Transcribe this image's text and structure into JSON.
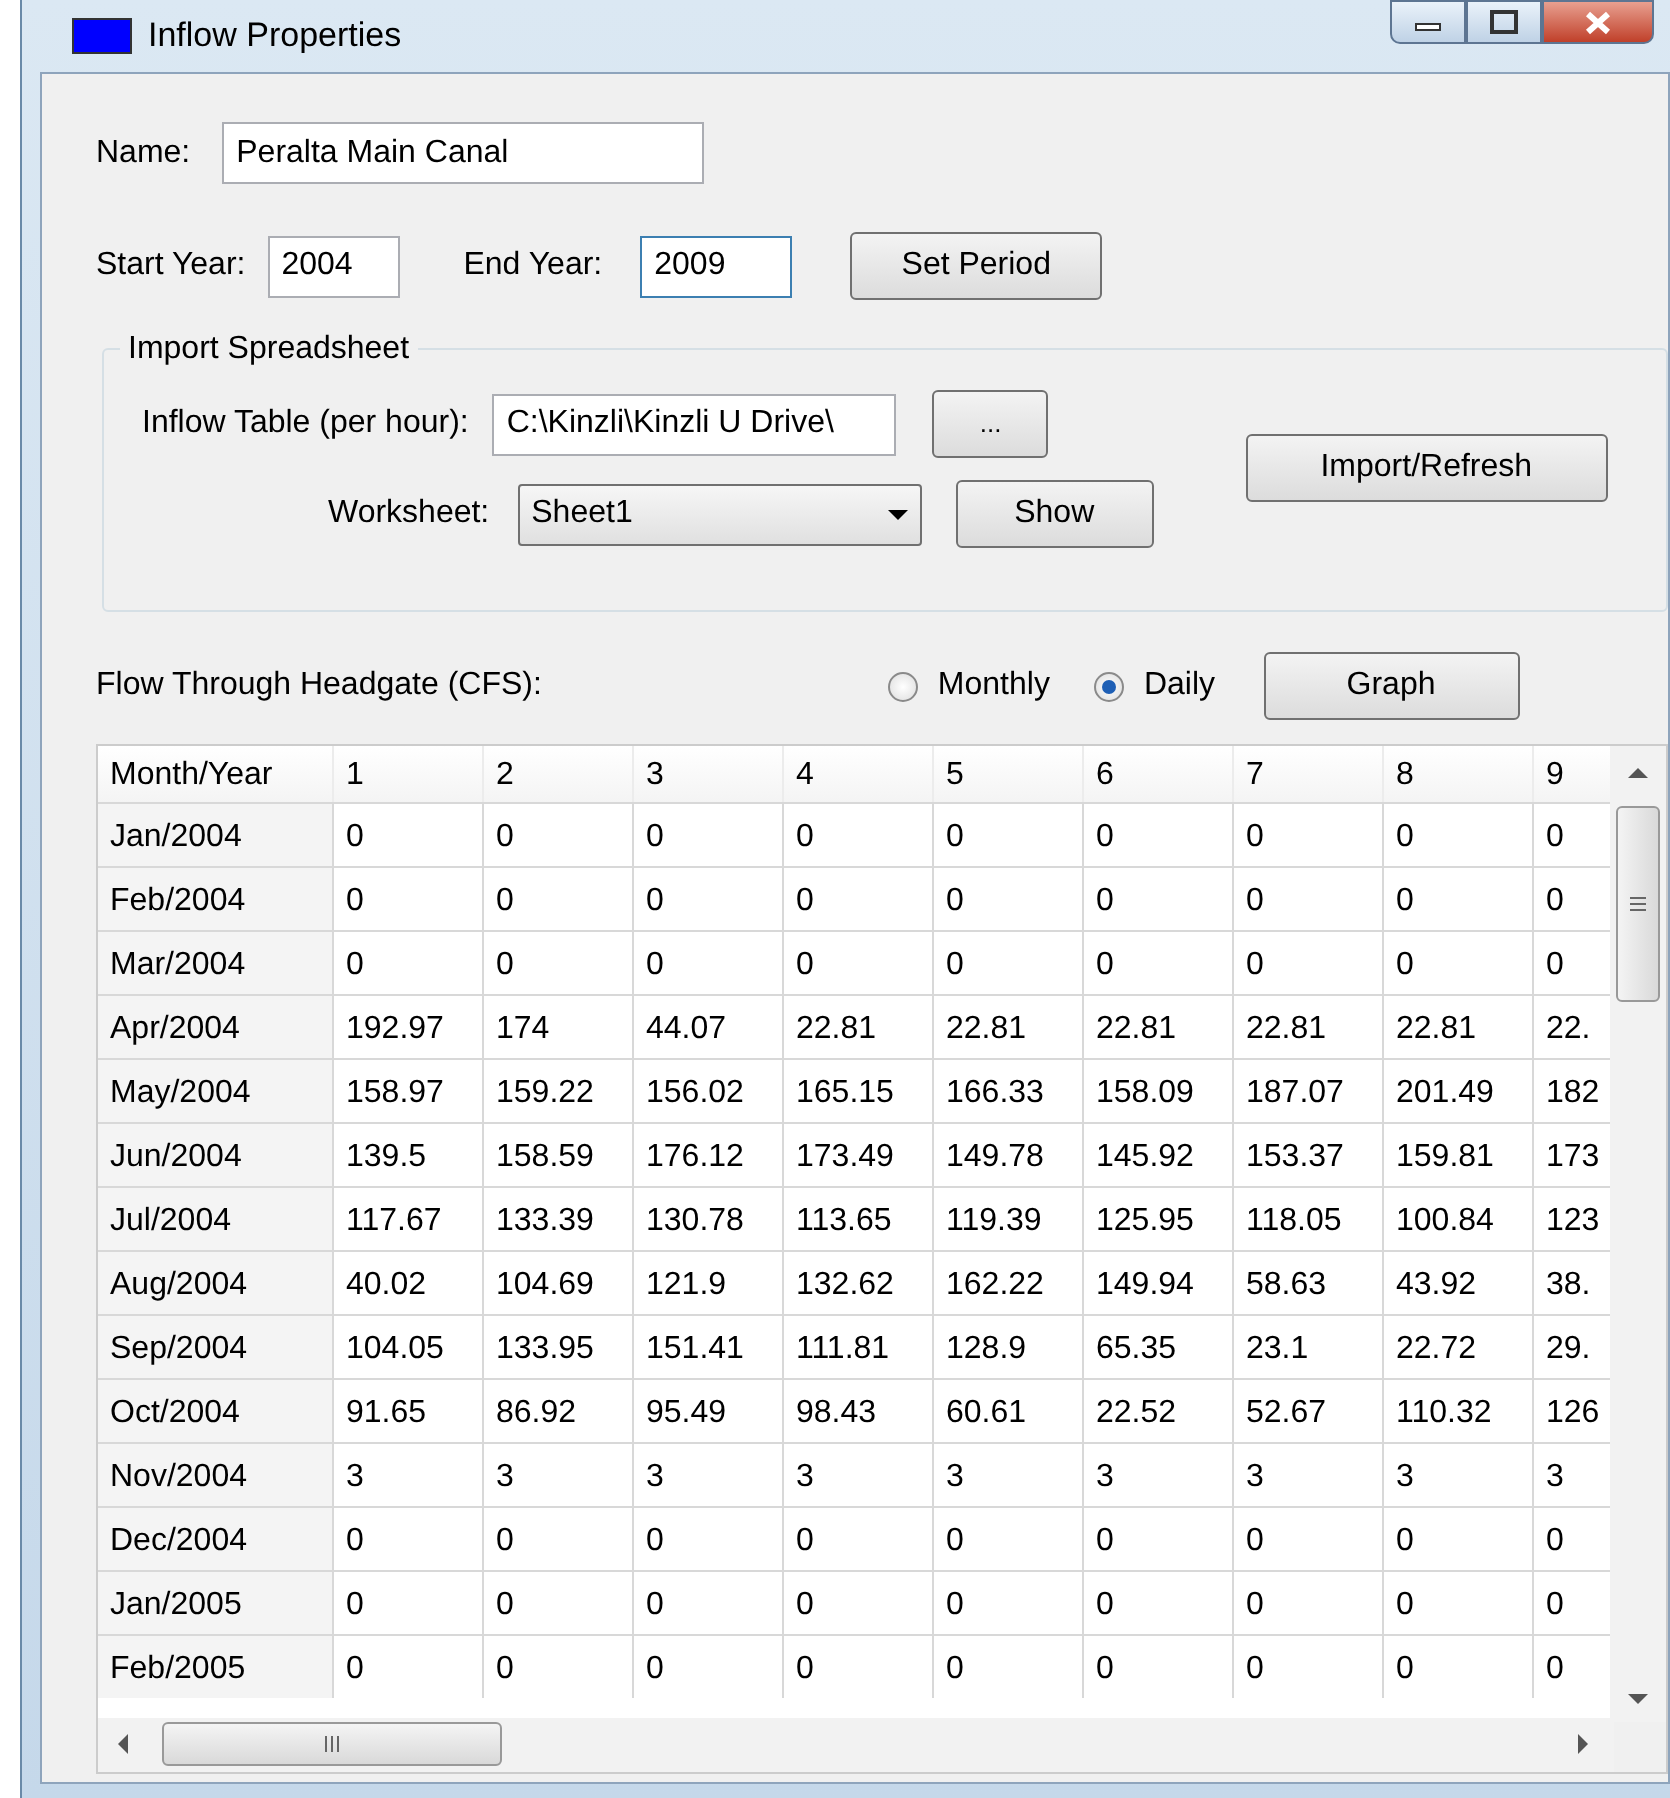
{
  "window": {
    "title": "Inflow Properties"
  },
  "name": {
    "label": "Name:",
    "value": "Peralta Main Canal"
  },
  "period": {
    "start_label": "Start Year:",
    "start_value": "2004",
    "end_label": "End Year:",
    "end_value": "2009",
    "button": "Set Period"
  },
  "import_group": {
    "title": "Import Spreadsheet",
    "table_label": "Inflow Table (per hour):",
    "table_value": "C:\\Kinzli\\Kinzli U Drive\\",
    "browse_button": "...",
    "worksheet_label": "Worksheet:",
    "worksheet_value": "Sheet1",
    "show_button": "Show",
    "import_button": "Import/Refresh"
  },
  "flow": {
    "label": "Flow Through Headgate (CFS):",
    "options": [
      {
        "label": "Monthly",
        "selected": false
      },
      {
        "label": "Daily",
        "selected": true
      }
    ],
    "graph_button": "Graph"
  },
  "table": {
    "columns": [
      "Month/Year",
      "1",
      "2",
      "3",
      "4",
      "5",
      "6",
      "7",
      "8",
      "9"
    ],
    "rows": [
      [
        "Jan/2004",
        "0",
        "0",
        "0",
        "0",
        "0",
        "0",
        "0",
        "0",
        "0"
      ],
      [
        "Feb/2004",
        "0",
        "0",
        "0",
        "0",
        "0",
        "0",
        "0",
        "0",
        "0"
      ],
      [
        "Mar/2004",
        "0",
        "0",
        "0",
        "0",
        "0",
        "0",
        "0",
        "0",
        "0"
      ],
      [
        "Apr/2004",
        "192.97",
        "174",
        "44.07",
        "22.81",
        "22.81",
        "22.81",
        "22.81",
        "22.81",
        "22."
      ],
      [
        "May/2004",
        "158.97",
        "159.22",
        "156.02",
        "165.15",
        "166.33",
        "158.09",
        "187.07",
        "201.49",
        "182"
      ],
      [
        "Jun/2004",
        "139.5",
        "158.59",
        "176.12",
        "173.49",
        "149.78",
        "145.92",
        "153.37",
        "159.81",
        "173"
      ],
      [
        "Jul/2004",
        "117.67",
        "133.39",
        "130.78",
        "113.65",
        "119.39",
        "125.95",
        "118.05",
        "100.84",
        "123"
      ],
      [
        "Aug/2004",
        "40.02",
        "104.69",
        "121.9",
        "132.62",
        "162.22",
        "149.94",
        "58.63",
        "43.92",
        "38."
      ],
      [
        "Sep/2004",
        "104.05",
        "133.95",
        "151.41",
        "111.81",
        "128.9",
        "65.35",
        "23.1",
        "22.72",
        "29."
      ],
      [
        "Oct/2004",
        "91.65",
        "86.92",
        "95.49",
        "98.43",
        "60.61",
        "22.52",
        "52.67",
        "110.32",
        "126"
      ],
      [
        "Nov/2004",
        "3",
        "3",
        "3",
        "3",
        "3",
        "3",
        "3",
        "3",
        "3"
      ],
      [
        "Dec/2004",
        "0",
        "0",
        "0",
        "0",
        "0",
        "0",
        "0",
        "0",
        "0"
      ],
      [
        "Jan/2005",
        "0",
        "0",
        "0",
        "0",
        "0",
        "0",
        "0",
        "0",
        "0"
      ],
      [
        "Feb/2005",
        "0",
        "0",
        "0",
        "0",
        "0",
        "0",
        "0",
        "0",
        "0"
      ]
    ]
  }
}
